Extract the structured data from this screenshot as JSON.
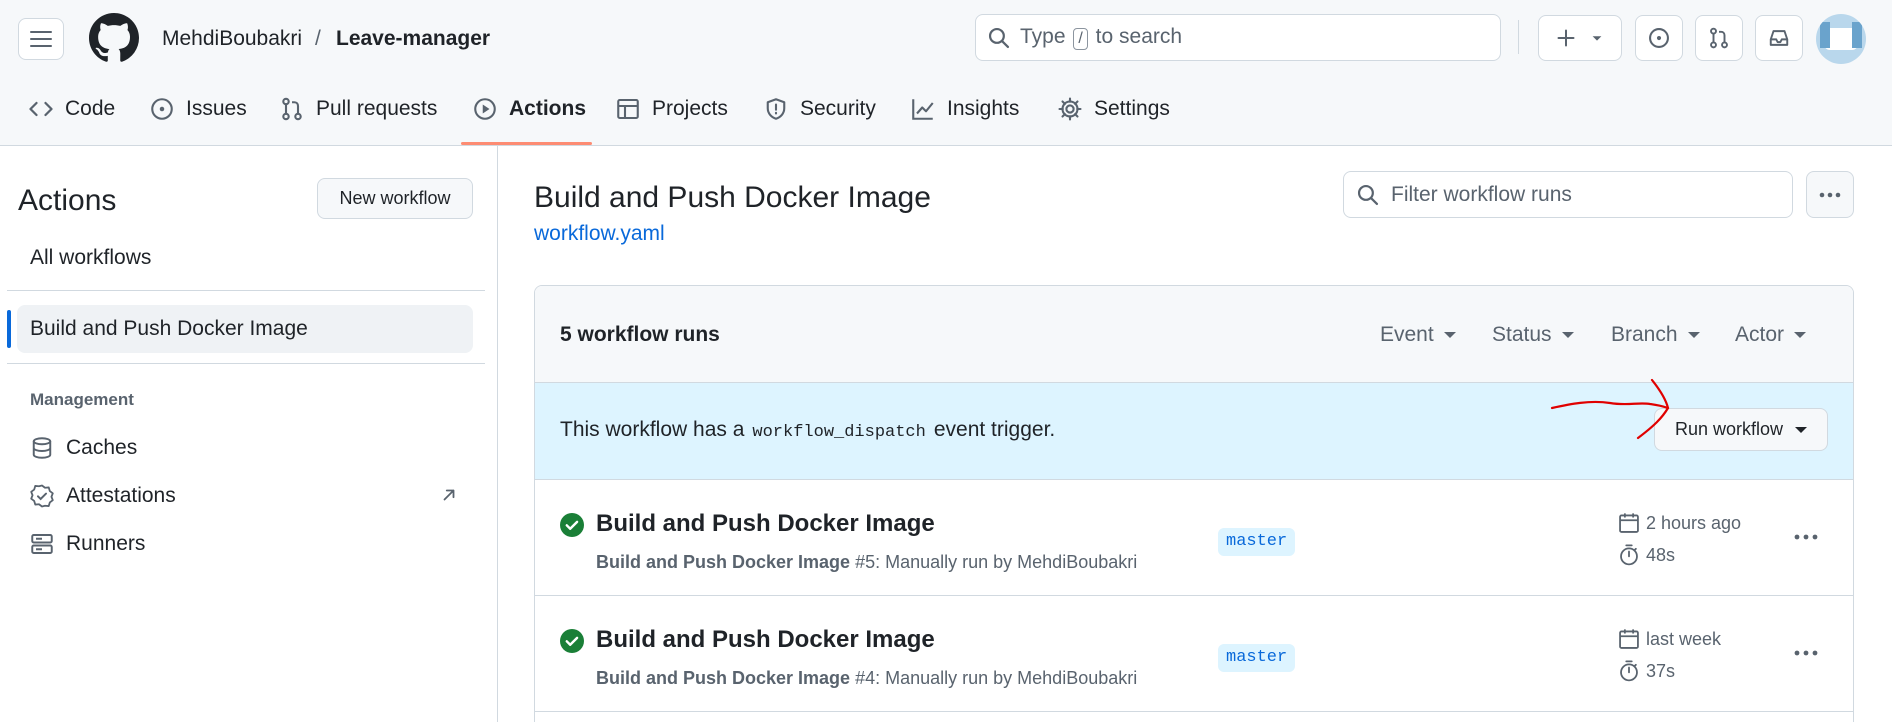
{
  "header": {
    "owner": "MehdiBoubakri",
    "separator": "/",
    "repo": "Leave-manager",
    "search_prefix": "Type",
    "search_key": "/",
    "search_suffix": "to search"
  },
  "nav": {
    "tabs": [
      {
        "label": "Code",
        "icon": "code-icon"
      },
      {
        "label": "Issues",
        "icon": "issue-opened-icon"
      },
      {
        "label": "Pull requests",
        "icon": "git-pull-request-icon"
      },
      {
        "label": "Actions",
        "icon": "play-icon",
        "active": true
      },
      {
        "label": "Projects",
        "icon": "table-icon"
      },
      {
        "label": "Security",
        "icon": "shield-icon"
      },
      {
        "label": "Insights",
        "icon": "graph-icon"
      },
      {
        "label": "Settings",
        "icon": "gear-icon"
      }
    ]
  },
  "sidebar": {
    "title": "Actions",
    "new_workflow": "New workflow",
    "all_workflows": "All workflows",
    "selected_workflow": "Build and Push Docker Image",
    "management_heading": "Management",
    "management_items": [
      {
        "label": "Caches",
        "icon": "database-icon"
      },
      {
        "label": "Attestations",
        "icon": "verified-icon"
      },
      {
        "label": "Runners",
        "icon": "server-icon"
      }
    ]
  },
  "main": {
    "title": "Build and Push Docker Image",
    "file_link": "workflow.yaml",
    "filter_placeholder": "Filter workflow runs",
    "runs_count": "5 workflow runs",
    "filters": [
      "Event",
      "Status",
      "Branch",
      "Actor"
    ],
    "dispatch": {
      "before": "This workflow has a",
      "code": "workflow_dispatch",
      "after": "event trigger.",
      "button": "Run workflow"
    },
    "runs": [
      {
        "title": "Build and Push Docker Image",
        "workflow": "Build and Push Docker Image",
        "detail": "#5: Manually run by MehdiBoubakri",
        "branch": "master",
        "when": "2 hours ago",
        "duration": "48s",
        "status": "success"
      },
      {
        "title": "Build and Push Docker Image",
        "workflow": "Build and Push Docker Image",
        "detail": "#4: Manually run by MehdiBoubakri",
        "branch": "master",
        "when": "last week",
        "duration": "37s",
        "status": "success"
      }
    ]
  },
  "colors": {
    "accent": "#0969da",
    "success": "#1a7f37",
    "tab_underline": "#fd8c73",
    "annotation": "#e00000",
    "dispatch_bg": "#ddf4ff"
  }
}
